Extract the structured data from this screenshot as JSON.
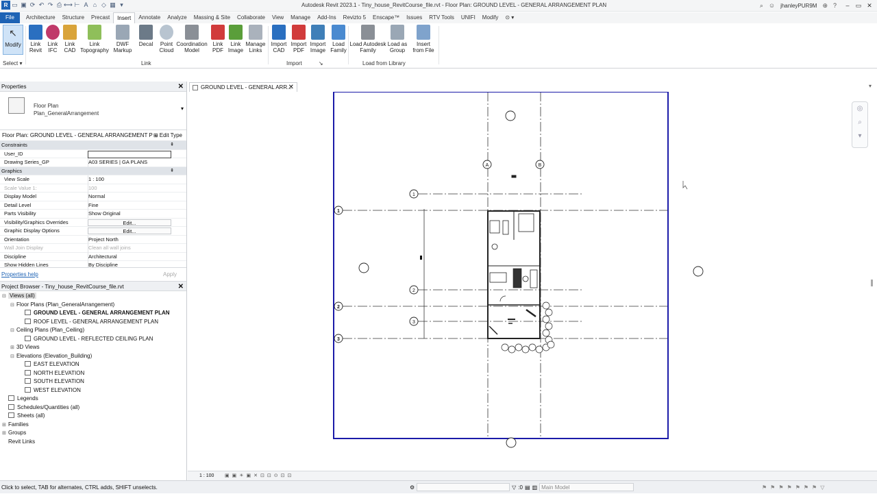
{
  "window": {
    "title": "Autodesk Revit 2023.1 - Tiny_house_RevitCourse_file.rvt - Floor Plan: GROUND LEVEL - GENERAL ARRANGEMENT PLAN",
    "user": "jhanleyPUR9M"
  },
  "tabs": [
    "File",
    "Architecture",
    "Structure",
    "Precast",
    "Insert",
    "Annotate",
    "Analyze",
    "Massing & Site",
    "Collaborate",
    "View",
    "Manage",
    "Add-Ins",
    "Revizto 5",
    "Enscape™",
    "Issues",
    "RTV Tools",
    "UNIFI",
    "Modify"
  ],
  "active_tab": "Insert",
  "ribbon": {
    "modify": "Modify",
    "select": "Select",
    "buttons": [
      {
        "l1": "Link",
        "l2": "Revit"
      },
      {
        "l1": "Link",
        "l2": "IFC"
      },
      {
        "l1": "Link",
        "l2": "CAD"
      },
      {
        "l1": "Link",
        "l2": "Topography"
      },
      {
        "l1": "DWF",
        "l2": "Markup"
      },
      {
        "l1": "Decal",
        "l2": ""
      },
      {
        "l1": "Point",
        "l2": "Cloud"
      },
      {
        "l1": "Coordination",
        "l2": "Model"
      },
      {
        "l1": "Link",
        "l2": "PDF"
      },
      {
        "l1": "Link",
        "l2": "Image"
      },
      {
        "l1": "Manage",
        "l2": "Links"
      },
      {
        "l1": "Import",
        "l2": "CAD"
      },
      {
        "l1": "Import",
        "l2": "PDF"
      },
      {
        "l1": "Import",
        "l2": "Image"
      },
      {
        "l1": "Load",
        "l2": "Family"
      },
      {
        "l1": "Load Autodesk",
        "l2": "Family"
      },
      {
        "l1": "Load as",
        "l2": "Group"
      },
      {
        "l1": "Insert",
        "l2": "from File"
      }
    ],
    "panels": {
      "link": "Link",
      "import": "Import",
      "library": "Load from Library"
    },
    "colors": {
      "blue": "#2a6fc0",
      "red": "#d13b3b",
      "green": "#5a9e3a",
      "gray": "#8a8f96"
    }
  },
  "properties": {
    "header": "Properties",
    "type_line1": "Floor Plan",
    "type_line2": "Plan_GeneralArrangement",
    "instance": "Floor Plan: GROUND LEVEL - GENERAL ARRANGEMENT P",
    "edit_type": "Edit Type",
    "rows": [
      {
        "k": "Constraints",
        "v": "",
        "kind": "grp"
      },
      {
        "k": "User_ID",
        "v": "",
        "kind": "input"
      },
      {
        "k": "Drawing Series_GP",
        "v": "A03 SERIES | GA PLANS",
        "kind": ""
      },
      {
        "k": "Graphics",
        "v": "",
        "kind": "grp"
      },
      {
        "k": "View Scale",
        "v": "1 : 100",
        "kind": ""
      },
      {
        "k": "Scale Value    1:",
        "v": "100",
        "kind": "dim"
      },
      {
        "k": "Display Model",
        "v": "Normal",
        "kind": ""
      },
      {
        "k": "Detail Level",
        "v": "Fine",
        "kind": ""
      },
      {
        "k": "Parts Visibility",
        "v": "Show Original",
        "kind": ""
      },
      {
        "k": "Visibility/Graphics Overrides",
        "v": "Edit...",
        "kind": "btn"
      },
      {
        "k": "Graphic Display Options",
        "v": "Edit...",
        "kind": "btn"
      },
      {
        "k": "Orientation",
        "v": "Project North",
        "kind": ""
      },
      {
        "k": "Wall Join Display",
        "v": "Clean all wall joins",
        "kind": "dim"
      },
      {
        "k": "Discipline",
        "v": "Architectural",
        "kind": ""
      },
      {
        "k": "Show Hidden Lines",
        "v": "By Discipline",
        "kind": ""
      }
    ],
    "help": "Properties help",
    "apply": "Apply"
  },
  "browser": {
    "header": "Project Browser - Tiny_house_RevitCourse_file.rvt",
    "items": [
      {
        "label": "Views (all)",
        "lvl": 0,
        "tg": "⊟",
        "bx": false,
        "bold": false,
        "sel": true
      },
      {
        "label": "Floor Plans (Plan_GeneralArrangement)",
        "lvl": 1,
        "tg": "⊟",
        "bx": false,
        "bold": false,
        "sel": false
      },
      {
        "label": "GROUND LEVEL - GENERAL ARRANGEMENT PLAN",
        "lvl": 2,
        "tg": "",
        "bx": true,
        "bold": true,
        "sel": false
      },
      {
        "label": "ROOF LEVEL - GENERAL ARRANGEMENT PLAN",
        "lvl": 2,
        "tg": "",
        "bx": true,
        "bold": false,
        "sel": false
      },
      {
        "label": "Ceiling Plans (Plan_Ceiling)",
        "lvl": 1,
        "tg": "⊟",
        "bx": false,
        "bold": false,
        "sel": false
      },
      {
        "label": "GROUND LEVEL - REFLECTED CEILING PLAN",
        "lvl": 2,
        "tg": "",
        "bx": true,
        "bold": false,
        "sel": false
      },
      {
        "label": "3D Views",
        "lvl": 1,
        "tg": "⊞",
        "bx": false,
        "bold": false,
        "sel": false
      },
      {
        "label": "Elevations (Elevation_Building)",
        "lvl": 1,
        "tg": "⊟",
        "bx": false,
        "bold": false,
        "sel": false
      },
      {
        "label": "EAST ELEVATION",
        "lvl": 2,
        "tg": "",
        "bx": true,
        "bold": false,
        "sel": false
      },
      {
        "label": "NORTH ELEVATION",
        "lvl": 2,
        "tg": "",
        "bx": true,
        "bold": false,
        "sel": false
      },
      {
        "label": "SOUTH ELEVATION",
        "lvl": 2,
        "tg": "",
        "bx": true,
        "bold": false,
        "sel": false
      },
      {
        "label": "WEST ELEVATION",
        "lvl": 2,
        "tg": "",
        "bx": true,
        "bold": false,
        "sel": false
      },
      {
        "label": "Legends",
        "lvl": 0,
        "tg": "",
        "bx": true,
        "bold": false,
        "sel": false
      },
      {
        "label": "Schedules/Quantities (all)",
        "lvl": 0,
        "tg": "",
        "bx": true,
        "bold": false,
        "sel": false
      },
      {
        "label": "Sheets (all)",
        "lvl": 0,
        "tg": "",
        "bx": true,
        "bold": false,
        "sel": false
      },
      {
        "label": "Families",
        "lvl": 0,
        "tg": "⊞",
        "bx": false,
        "bold": false,
        "sel": false
      },
      {
        "label": "Groups",
        "lvl": 0,
        "tg": "⊞",
        "bx": false,
        "bold": false,
        "sel": false
      },
      {
        "label": "Revit Links",
        "lvl": 0,
        "tg": "",
        "bx": false,
        "bold": false,
        "sel": false
      }
    ]
  },
  "view": {
    "tab_label": "GROUND LEVEL - GENERAL ARR...",
    "scale": "1 : 100",
    "grid_labels": {
      "a": "A",
      "b": "B",
      "r1": "1",
      "r2": "2",
      "r3": "3"
    }
  },
  "status": {
    "message": "Click to select, TAB for alternates, CTRL adds, SHIFT unselects.",
    "sel_count": ":0",
    "model": "Main Model"
  }
}
